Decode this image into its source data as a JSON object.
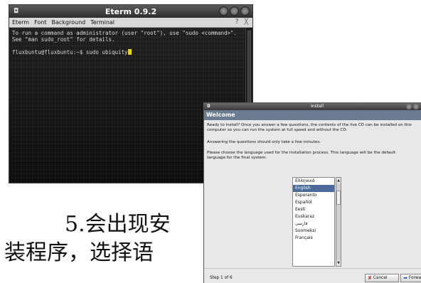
{
  "eterm": {
    "title": "Eterm 0.9.2",
    "menu": [
      "Eterm",
      "Font",
      "Background",
      "Terminal"
    ],
    "menu_right": [
      "?",
      "╳"
    ],
    "lines": [
      "To run a command as administrator (user \"root\"), use \"sudo <command>\".",
      "See \"man sudo_root\" for details.",
      "",
      "fluxbuntu@fluxbuntu:~$ sudo ubiquity"
    ]
  },
  "install": {
    "title": "Install",
    "header": "Welcome",
    "paragraph_1": "Ready to install? Once you answer a few questions, the contents of the live CD can be installed on this computer so you can run the system at full speed and without the CD.",
    "paragraph_2": "Answering the questions should only take a few minutes.",
    "paragraph_3": "Please choose the language used for the installation process. This language will be the default language for the final system.",
    "languages": [
      "Ελληνικά",
      "English",
      "Esperanto",
      "Español",
      "Eesti",
      "Euskaraz",
      "فارسی",
      "Suomeksi",
      "Français"
    ],
    "selected_language": "English",
    "step": "Step 1 of 6",
    "cancel_label": "Cancel",
    "forward_label": "Forward"
  },
  "caption": {
    "line1": "5.会出现安",
    "line2": "装程序，选择语"
  },
  "colors": {
    "terminal_bg": "#141414",
    "cursor": "#e8d400",
    "header_bg": "#6b7b92",
    "selection": "#4a6a9a",
    "cancel_icon": "#c0281c"
  },
  "icons": [
    "window-menu-icon",
    "window-buttons-icon",
    "cancel-x-icon",
    "forward-icon"
  ]
}
